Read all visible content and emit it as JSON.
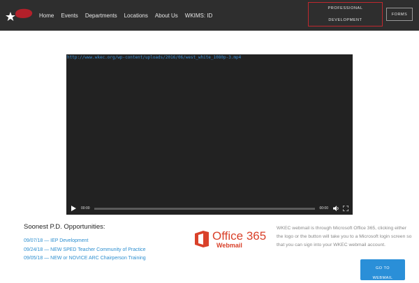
{
  "header": {
    "logo_icon": "star-logo-icon",
    "nav": [
      "Home",
      "Events",
      "Departments",
      "Locations",
      "About Us",
      "WKIMS: ID"
    ],
    "pd_button_line1": "PROFESSIONAL",
    "pd_button_line2": "DEVELOPMENT",
    "forms_label": "FORMS",
    "accent_color": "#c0282e"
  },
  "video": {
    "url": "http://www.wkec.org/wp-content/uploads/2016/06/west_white_1080p-3.mp4",
    "current_time": "00:00",
    "duration": "00:00",
    "progress": 0
  },
  "pd": {
    "title": "Soonest P.D. Opportunities:",
    "items": [
      "09/07/18 — IEP Development",
      "09/24/18 — NEW SPED Teacher Community of Practice",
      "09/05/18 — NEW or NOVICE ARC Chairperson Training"
    ]
  },
  "office": {
    "logo_text": "Office 365",
    "logo_sub": "Webmail",
    "brand_color": "#d9412a"
  },
  "webmail": {
    "description": "WKEC webmail is through Microsoft Office 365, clicking either the logo or the button will take you to a Microsoft login screen so that you can sign into your WKEC webmail account.",
    "button_line1": "GO TO",
    "button_line2": "WEBMAIL",
    "button_color": "#2a8fd8"
  }
}
